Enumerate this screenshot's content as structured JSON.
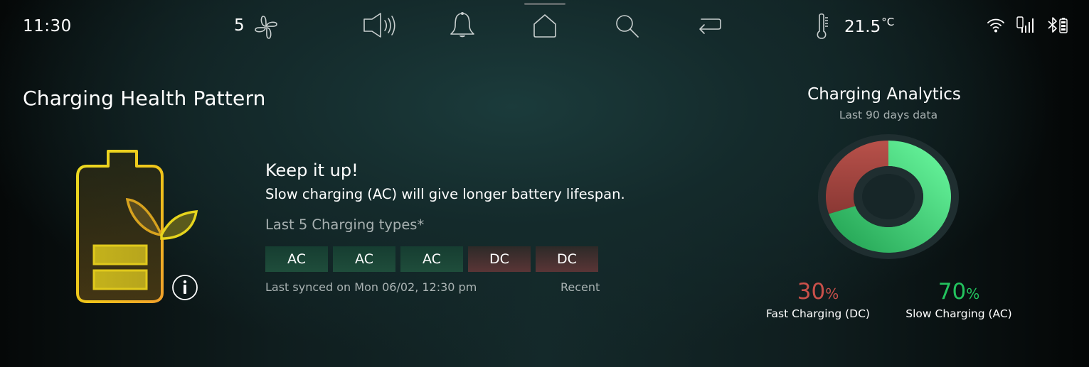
{
  "status_bar": {
    "time": "11:30",
    "fan_speed": "5",
    "temperature_value": "21.5",
    "temperature_unit": "°C",
    "icons": {
      "fan": "fan-icon",
      "volume": "volume-icon",
      "notifications": "bell-icon",
      "home": "home-icon",
      "search": "search-icon",
      "back": "back-icon",
      "thermometer": "thermometer-icon",
      "wifi": "wifi-icon",
      "phone_signal": "phone-signal-icon",
      "bluetooth": "bluetooth-icon",
      "battery": "battery-icon"
    }
  },
  "health": {
    "title": "Charging Health Pattern",
    "illustration": "eco-battery-icon",
    "info_icon": "info-icon",
    "headline": "Keep it up!",
    "message": "Slow charging (AC) will give longer battery lifespan.",
    "history_label": "Last 5 Charging types*",
    "history": [
      {
        "type": "AC"
      },
      {
        "type": "AC"
      },
      {
        "type": "AC"
      },
      {
        "type": "DC"
      },
      {
        "type": "DC"
      }
    ],
    "last_synced": "Last synced on Mon 06/02, 12:30 pm",
    "recent_label": "Recent"
  },
  "analytics": {
    "title": "Charging Analytics",
    "subtitle": "Last 90 days data",
    "fast": {
      "value": "30",
      "unit": "%",
      "label": "Fast Charging (DC)"
    },
    "slow": {
      "value": "70",
      "unit": "%",
      "label": "Slow Charging (AC)"
    }
  },
  "colors": {
    "ac_chip": "#1f4d3b",
    "dc_chip": "#5a3536",
    "fast_text": "#c9504a",
    "slow_text": "#23c35e",
    "donut_fast": "#a8473f",
    "donut_slow": "#3fd27a",
    "donut_track": "#1f2e30",
    "accent_yellow": "#e8d21c"
  },
  "chart_data": {
    "type": "pie",
    "title": "Charging Analytics",
    "subtitle": "Last 90 days data",
    "categories": [
      "Fast Charging (DC)",
      "Slow Charging (AC)"
    ],
    "values": [
      30,
      70
    ],
    "unit": "%",
    "donut": true,
    "legend": "bottom"
  }
}
